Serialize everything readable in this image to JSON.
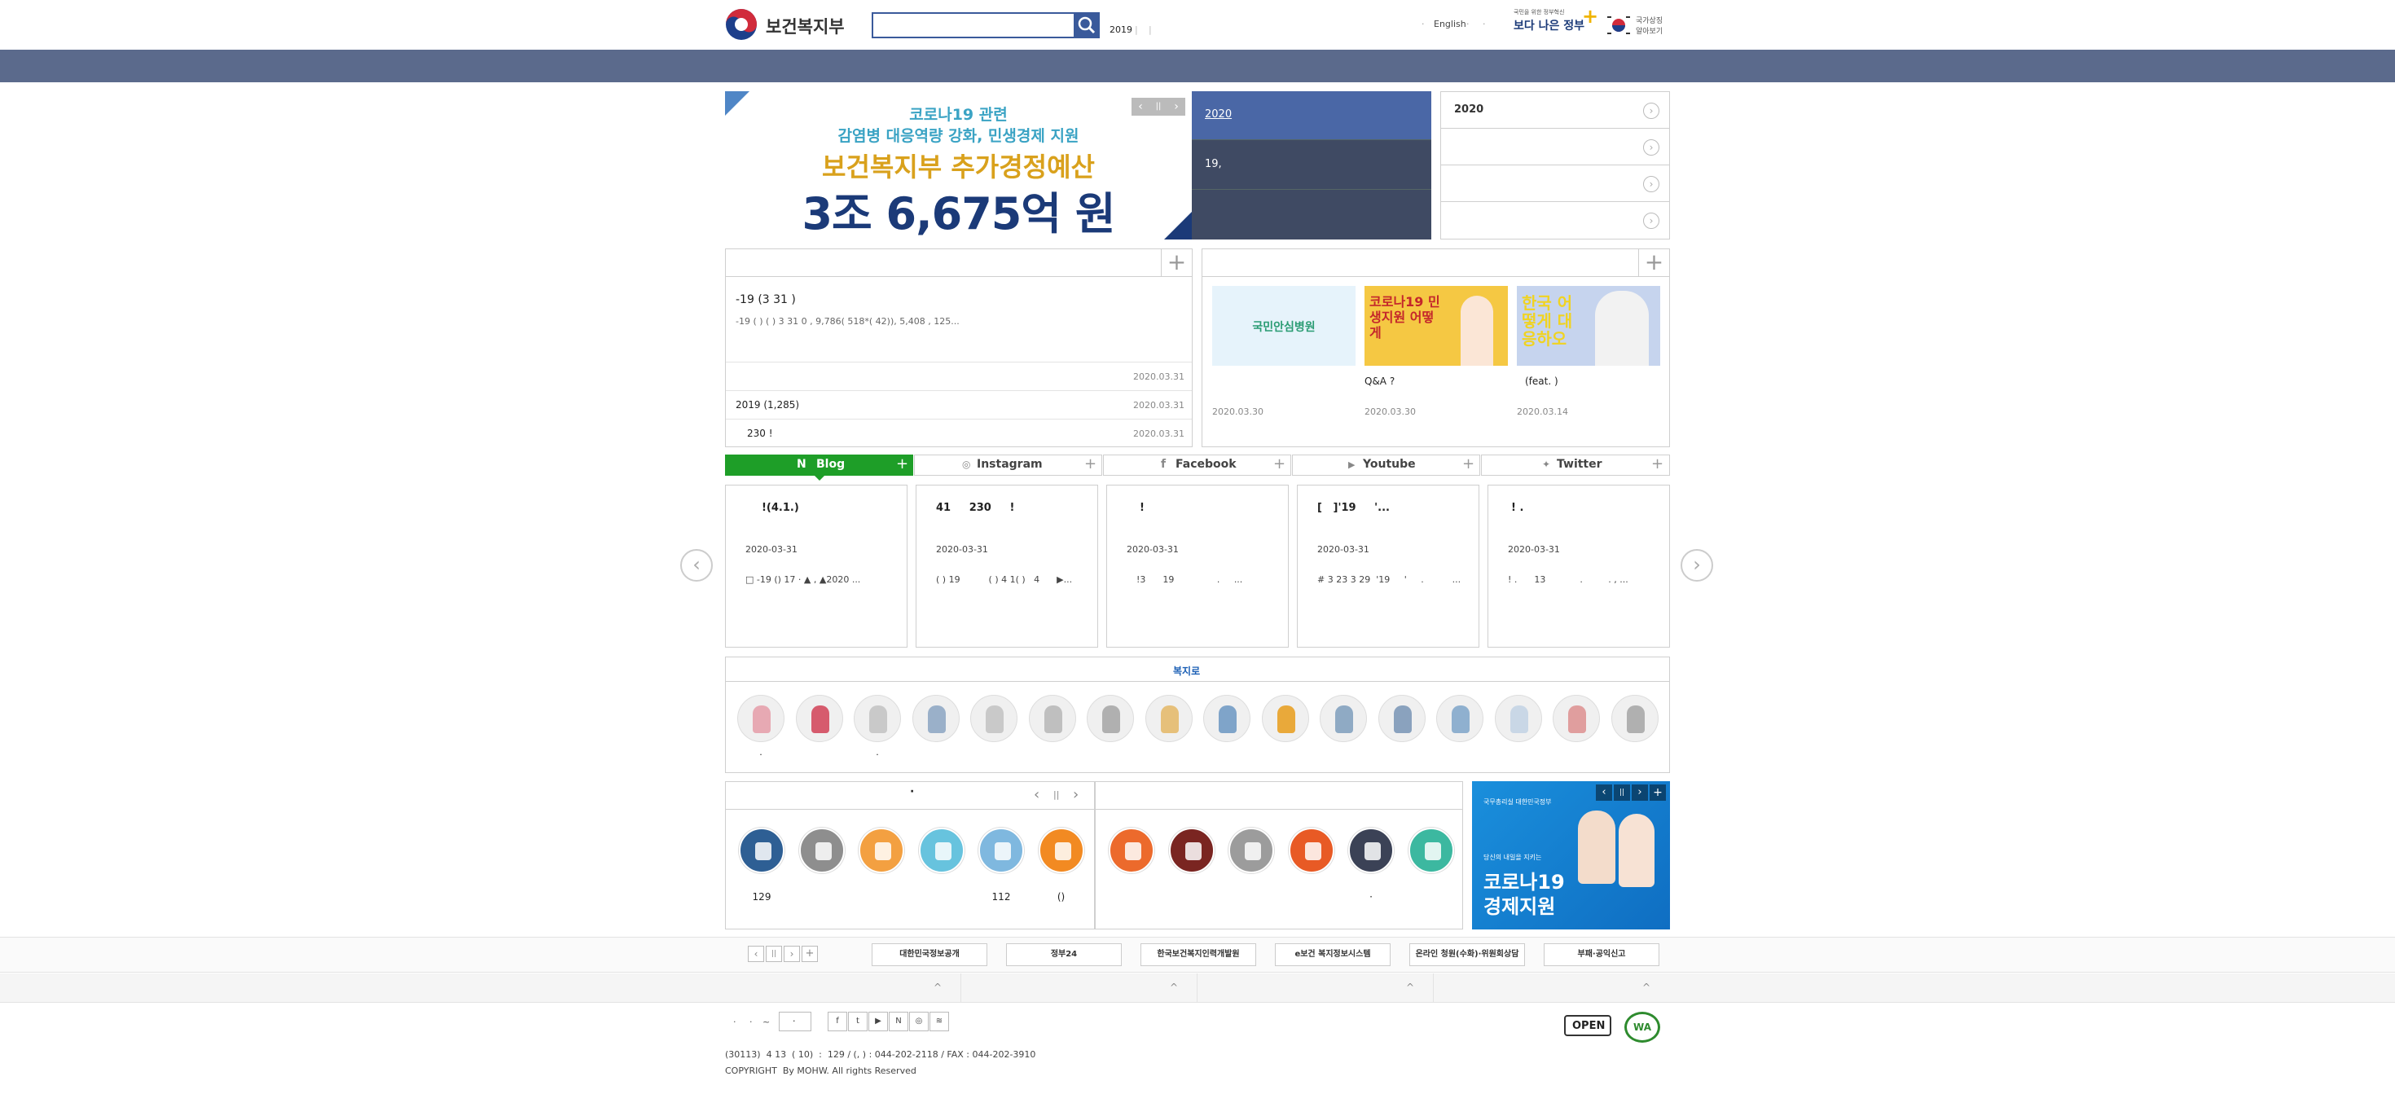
{
  "header": {
    "logo_text": "보건복지부",
    "search_placeholder": "",
    "keyword_year": "2019",
    "keyword_sep": "|",
    "keyword_sep2": "|",
    "lang_prefix": "·",
    "lang_label": "English",
    "lang_suffix": "·",
    "lang_suffix2": "·",
    "gov_slogan_top": "국민을 위한 정부혁신",
    "gov_slogan": "보다 나은 정부",
    "national_label_1": "국가상징",
    "national_label_2": "알아보기"
  },
  "banner": {
    "line1": "코로나19 관련",
    "line2": "감염병 대응역량 강화, 민생경제 지원",
    "line3": "보건복지부 추가경정예산",
    "line4": "3조 6,675억 원",
    "ctrl_prev": "‹",
    "ctrl_pause": "||",
    "ctrl_next": "›"
  },
  "news_side": {
    "items": [
      {
        "title": "2020",
        "active": true
      },
      {
        "title": "19,",
        "active": false
      },
      {
        "title": "",
        "active": false
      }
    ]
  },
  "quick_list": {
    "items": [
      {
        "title": "2020"
      },
      {
        "title": ""
      },
      {
        "title": ""
      },
      {
        "title": ""
      }
    ]
  },
  "notice": {
    "plus": "+",
    "headline": "-19   (3 31 )",
    "summary": "-19   ( ) ( ) 3 31 0 ,   9,786( 518*( 42)),   5,408   ,   125...",
    "rows": [
      {
        "title": "",
        "date": "2020.03.31"
      },
      {
        "title": "2019 (1,285)",
        "date": "2020.03.31"
      },
      {
        "title": "230    !",
        "date": "2020.03.31"
      }
    ]
  },
  "media": {
    "plus": "+",
    "items": [
      {
        "caption": "",
        "date": "2020.03.30",
        "thumb_text": "국민안심병원"
      },
      {
        "caption": "Q&A ?",
        "date": "2020.03.30",
        "thumb_text": "코로나19 민생지원 어떻게"
      },
      {
        "caption": "(feat. )",
        "date": "2020.03.14",
        "thumb_text": "한국 어떻게 대응하오"
      }
    ]
  },
  "sns_tabs": [
    {
      "label": "Blog",
      "icon": "N",
      "active": true
    },
    {
      "label": "Instagram",
      "icon": "◎",
      "active": false
    },
    {
      "label": "Facebook",
      "icon": "f",
      "active": false
    },
    {
      "label": "Youtube",
      "icon": "▶",
      "active": false
    },
    {
      "label": "Twitter",
      "icon": "✦",
      "active": false
    }
  ],
  "sns_plus": "+",
  "sns_cards": [
    {
      "title": "!(4.1.)",
      "date": "2020-03-31",
      "body": "□ -19   ()        17 ·  ▲     ,   ▲2020  ..."
    },
    {
      "title": "41     230     !",
      "date": "2020-03-31",
      "body": "( ) 19          ( ) 4 1( )   4      ▶..."
    },
    {
      "title": "!",
      "date": "2020-03-31",
      "body": "!3      19               .     ..."
    },
    {
      "title": "[   ]'19     '...",
      "date": "2020-03-31",
      "body": "# 3 23 3 29  '19     '     .          ..."
    },
    {
      "title": "! .",
      "date": "2020-03-31",
      "body": "! .      13            .         . , ..."
    }
  ],
  "sns_prev": "‹",
  "sns_next": "›",
  "welfare": {
    "logo": "복지로",
    "labels": [
      ".",
      "",
      ".",
      "",
      "",
      "",
      "",
      "",
      "",
      "",
      "",
      "",
      "",
      "",
      "",
      ""
    ]
  },
  "services": {
    "title": "·",
    "ctrl_prev": "‹",
    "ctrl_pause": "||",
    "ctrl_next": "›",
    "items": [
      {
        "label": "129"
      },
      {
        "label": ""
      },
      {
        "label": ""
      },
      {
        "label": ""
      },
      {
        "label": "112"
      },
      {
        "label": "()"
      }
    ]
  },
  "services2": {
    "title": "",
    "items": [
      {
        "label": ""
      },
      {
        "label": ""
      },
      {
        "label": ""
      },
      {
        "label": ""
      },
      {
        "label": "·"
      },
      {
        "label": ""
      }
    ]
  },
  "promo": {
    "ministry": "국무총리실 대한민국정부",
    "line1": "당신의 내일을 지키는",
    "line2": "코로나19",
    "line3": "경제지원",
    "ctrl_prev": "‹",
    "ctrl_pause": "||",
    "ctrl_next": "›",
    "ctrl_plus": "+"
  },
  "related": {
    "ctrl_prev": "‹",
    "ctrl_pause": "||",
    "ctrl_next": "›",
    "ctrl_plus": "+",
    "sites": [
      {
        "label": "대한민국정보공개"
      },
      {
        "label": "정부24"
      },
      {
        "label": "한국보건복지인력개발원"
      },
      {
        "label": "e보건 복지정보시스템"
      },
      {
        "label": "온라인 청원(수화)·위원회상담"
      },
      {
        "label": "부패·공익신고"
      }
    ]
  },
  "footer_toggle": {
    "arrows": [
      "^",
      "^",
      "^",
      "^"
    ]
  },
  "footer": {
    "links": [
      "·",
      "·",
      "~"
    ],
    "select_label": "·",
    "sns_icons": [
      "f",
      "t",
      "▶",
      "N",
      "◎",
      "≋"
    ],
    "address": "(30113)  4 13  ( 10)  :  129 / (, ) : 044-202-2118 / FAX : 044-202-3910",
    "copyright": "COPYRIGHT  By MOHW. All rights Reserved",
    "badge1": "OPEN",
    "badge2": "WA"
  },
  "colors": {
    "nav_bar": "#5b6a8c",
    "sidebar_active": "#4a67a6",
    "sidebar_dark": "#3f4a63",
    "blog_green": "#1e9e28",
    "banner_navy": "#1b3a78",
    "banner_gold": "#d9a11c",
    "banner_teal": "#3aa3c4"
  }
}
